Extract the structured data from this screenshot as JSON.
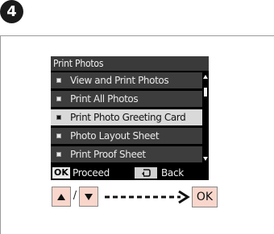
{
  "step": {
    "number": "4"
  },
  "screen": {
    "title": "Print Photos",
    "menu": [
      {
        "label": "View and Print Photos",
        "selected": false
      },
      {
        "label": "Print All Photos",
        "selected": false
      },
      {
        "label": "Print Photo Greeting Card",
        "selected": true
      },
      {
        "label": "Photo Layout Sheet",
        "selected": false
      },
      {
        "label": "Print Proof Sheet",
        "selected": false
      }
    ],
    "footer": {
      "ok_key": "OK",
      "ok_label": "Proceed",
      "back_label": "Back"
    }
  },
  "instruction": {
    "separator": "/",
    "ok_button": "OK"
  },
  "colors": {
    "button_fill": "#f9d6cc",
    "highlight": "#d9d9d9",
    "screen_bg": "#000000"
  }
}
